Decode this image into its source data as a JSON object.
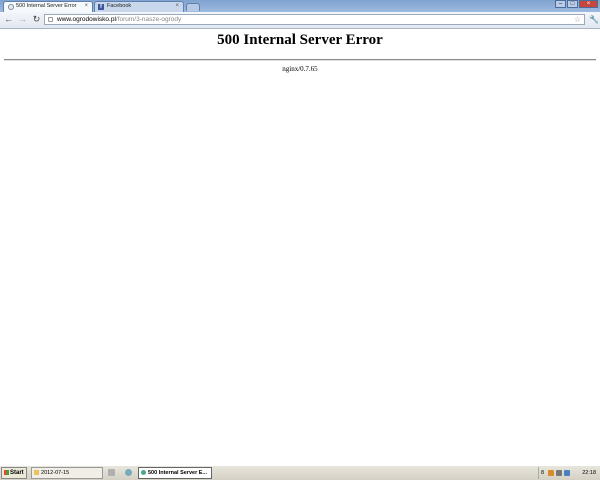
{
  "browser": {
    "tabs": [
      {
        "title": "500 Internal Server Error",
        "active": true
      },
      {
        "title": "Facebook",
        "active": false
      }
    ],
    "url_host": "www.ogrodowisko.pl",
    "url_path": "/forum/3-nasze-ogrody"
  },
  "page": {
    "heading": "500 Internal Server Error",
    "server": "nginx/0.7.65"
  },
  "taskbar": {
    "start_label": "Start",
    "items": [
      {
        "label": "2012-07-15"
      },
      {
        "label": "500 Internal Server E..."
      }
    ],
    "tray_number": "8",
    "clock": "22:18"
  },
  "colors": {
    "tabstrip": "#7fa2cf",
    "close_button": "#c9463d"
  }
}
